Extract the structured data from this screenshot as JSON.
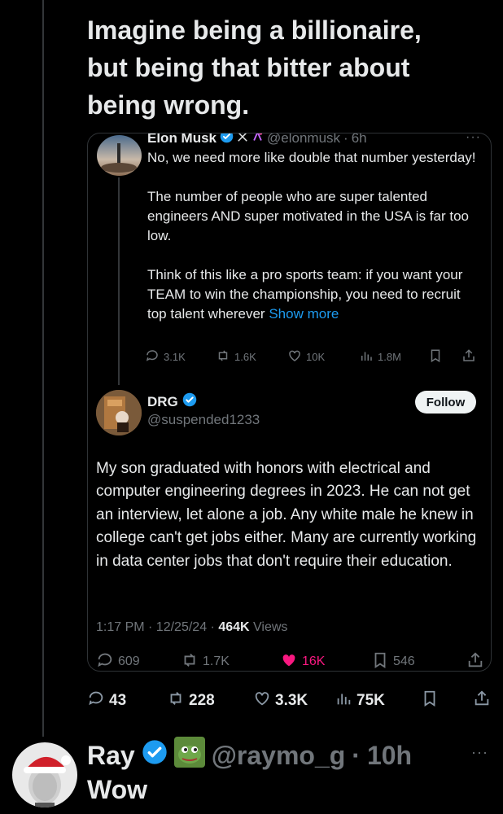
{
  "tweet": {
    "text": "Imagine being a billionaire,\nbut being that bitter about\nbeing wrong."
  },
  "parent": {
    "name": "Elon Musk",
    "handle": "@elonmusk",
    "time": "6h",
    "paragraphs": [
      "No, we need more like double that number yesterday!",
      "The number of people who are super talented engineers AND super motivated in the USA is far too low.",
      "Think of this like a pro sports team: if you want your TEAM to win the championship, you need to recruit top talent wherever"
    ],
    "show_more": "Show more",
    "replies": "3.1K",
    "reposts": "1.6K",
    "likes": "10K",
    "views": "1.8M"
  },
  "quoted": {
    "name": "DRG",
    "handle": "@suspended1233",
    "follow_label": "Follow",
    "text": "My son graduated with honors with electrical and computer engineering degrees in 2023. He can not get an interview, let alone a job.  Any white male he knew in college can't get jobs either. Many are currently working in data center jobs that don't require their education.",
    "time": "1:17 PM · 12/25/24 · ",
    "views_count": "464K",
    "views_label": " Views",
    "replies": "609",
    "reposts": "1.7K",
    "likes": "16K",
    "bookmarks": "546"
  },
  "stats": {
    "replies": "43",
    "reposts": "228",
    "likes": "3.3K",
    "views": "75K"
  },
  "reply": {
    "name": "Ray",
    "handle": "@raymo_g",
    "time": "10h",
    "text": "Wow"
  },
  "colors": {
    "background": "#000000",
    "text": "#e7e9ea",
    "muted": "#71767b",
    "link": "#1d9bf0",
    "verified": "#1d9bf0",
    "like_active": "#f91880"
  }
}
